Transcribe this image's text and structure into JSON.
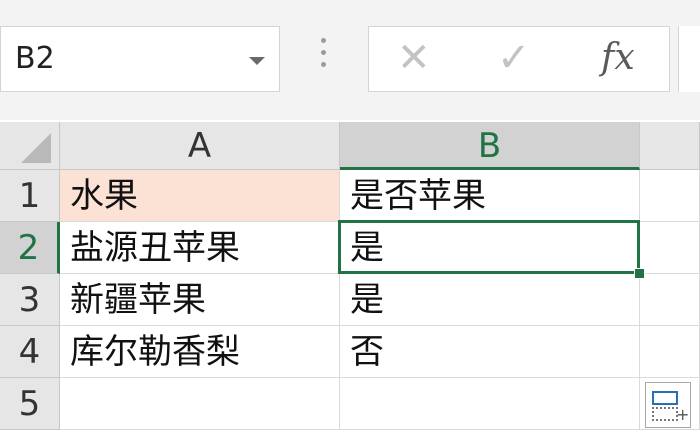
{
  "namebox": {
    "value": "B2"
  },
  "formula_bar": {
    "cancel_glyph": "✕",
    "enter_glyph": "✓",
    "fx_label": "fx",
    "value": ""
  },
  "columns": [
    {
      "label": "A"
    },
    {
      "label": "B"
    }
  ],
  "rows": [
    {
      "label": "1",
      "a": "水果",
      "b": "是否苹果"
    },
    {
      "label": "2",
      "a": "盐源丑苹果",
      "b": "是"
    },
    {
      "label": "3",
      "a": "新疆苹果",
      "b": "是"
    },
    {
      "label": "4",
      "a": "库尔勒香梨",
      "b": "否"
    },
    {
      "label": "5",
      "a": "",
      "b": ""
    }
  ],
  "selection": {
    "cell": "B2"
  },
  "colors": {
    "accent": "#217346",
    "header_fill": "#fbe2d5"
  },
  "quick_analysis": {
    "plus": "+"
  }
}
